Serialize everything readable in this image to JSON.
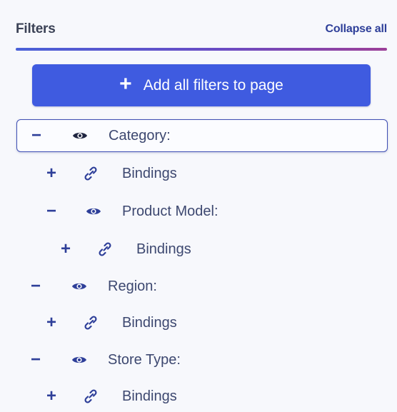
{
  "header": {
    "title": "Filters",
    "collapse_label": "Collapse all"
  },
  "add_button": {
    "plus": "+",
    "label": "Add all filters to page"
  },
  "tree": [
    {
      "toggle": "−",
      "icon": "eye-icon",
      "label": "Category:",
      "selected": true
    },
    {
      "toggle": "+",
      "icon": "link-icon",
      "label": "Bindings"
    },
    {
      "toggle": "−",
      "icon": "eye-icon",
      "label": "Product Model:"
    },
    {
      "toggle": "+",
      "icon": "link-icon",
      "label": "Bindings"
    },
    {
      "toggle": "−",
      "icon": "eye-icon",
      "label": "Region:"
    },
    {
      "toggle": "+",
      "icon": "link-icon",
      "label": "Bindings"
    },
    {
      "toggle": "−",
      "icon": "eye-icon",
      "label": "Store Type:"
    },
    {
      "toggle": "+",
      "icon": "link-icon",
      "label": "Bindings"
    }
  ],
  "colors": {
    "accent": "#3f5be0",
    "link": "#2e3f99",
    "text": "#3d4870",
    "background": "#f7f8fc"
  }
}
